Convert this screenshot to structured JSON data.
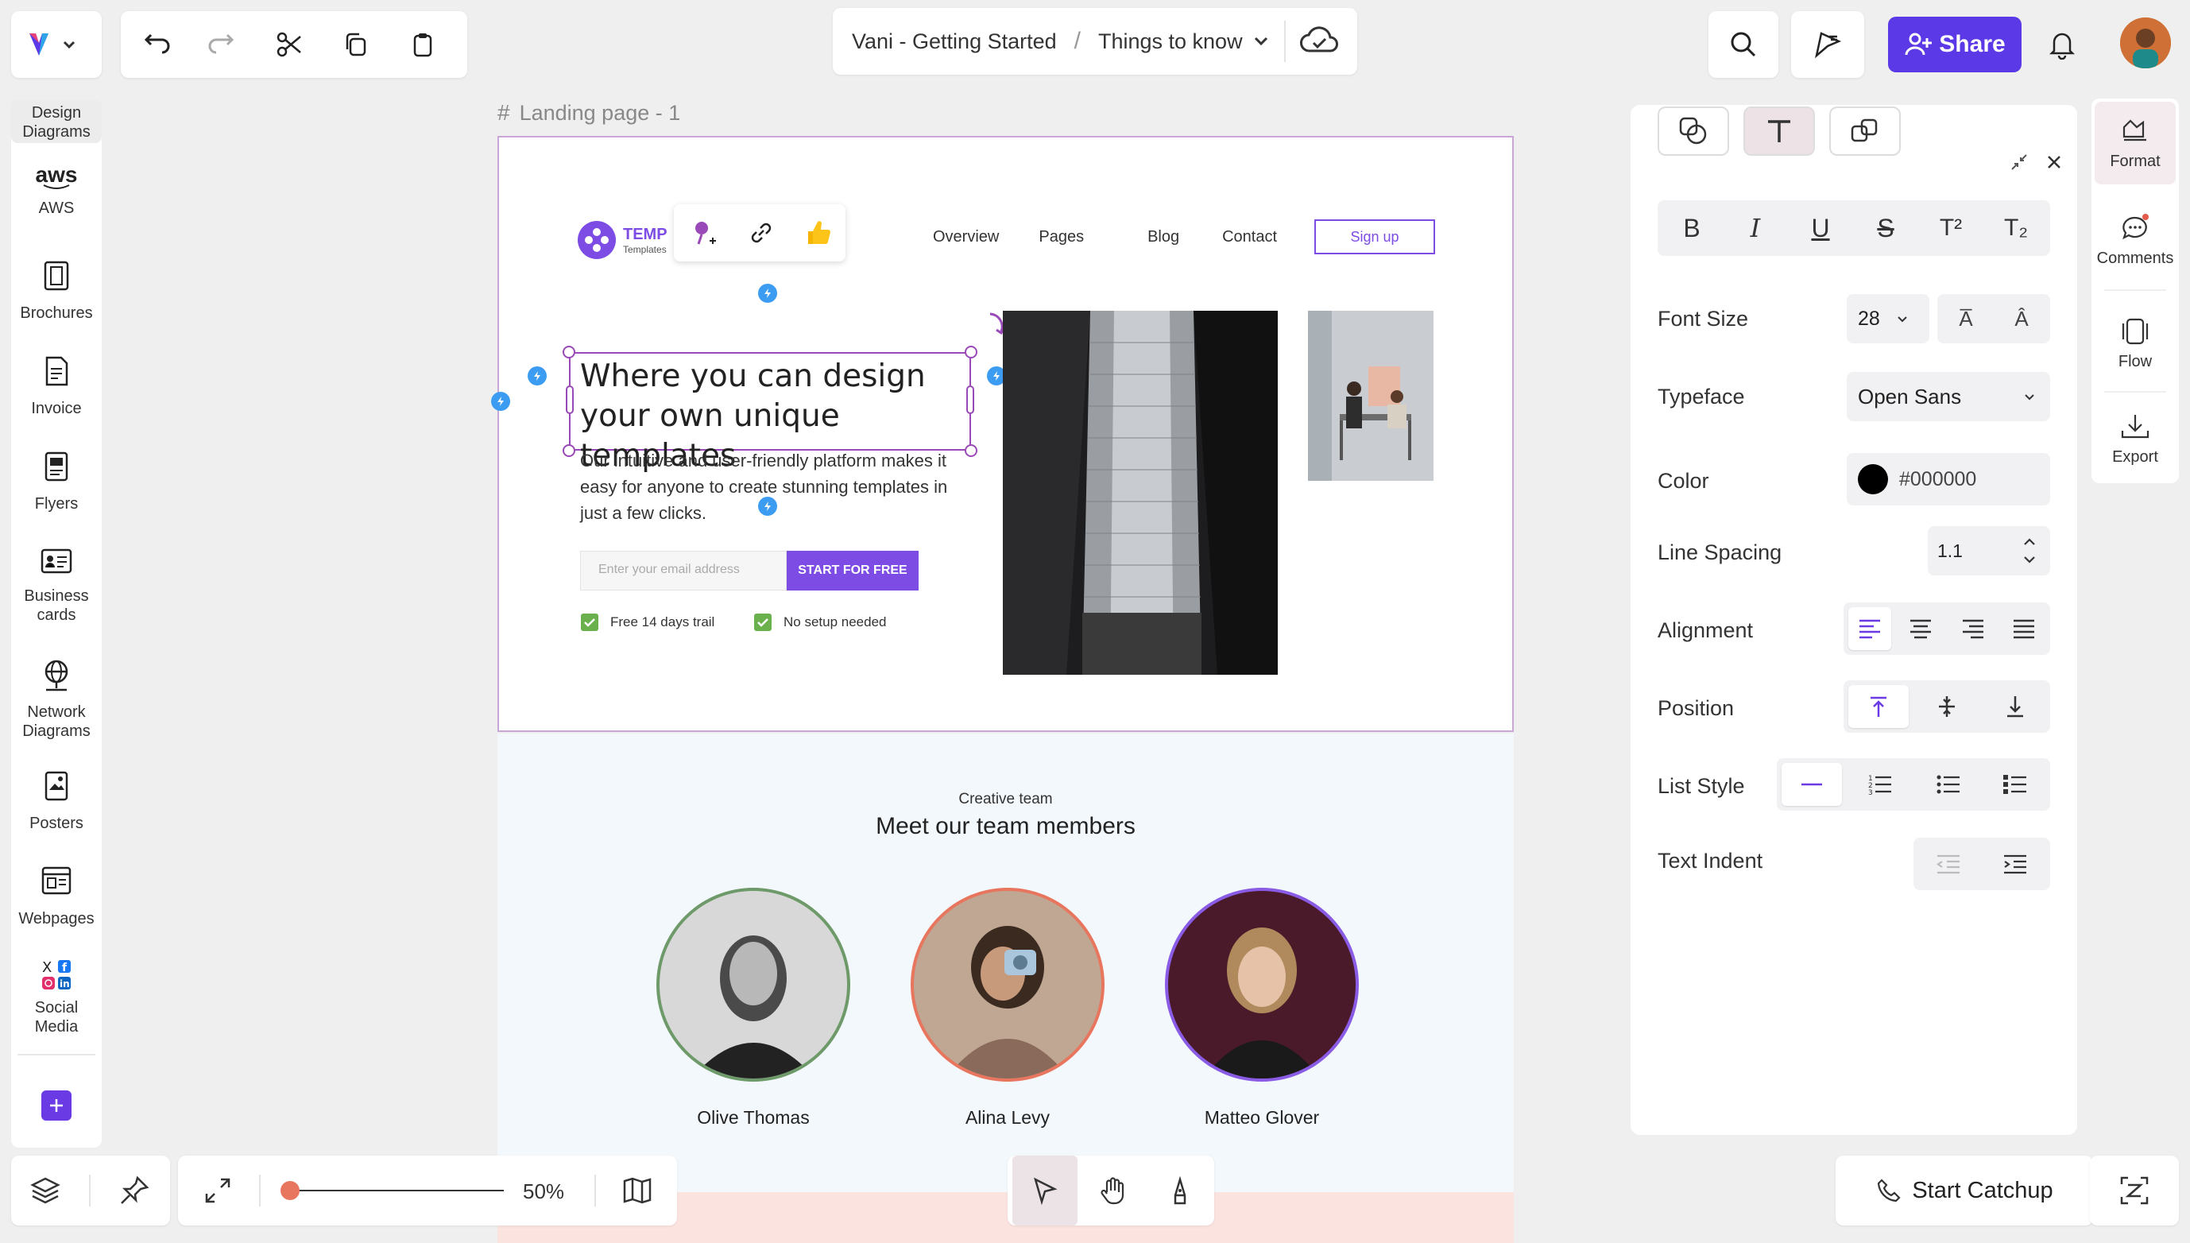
{
  "app": {
    "breadcrumb_project": "Vani - Getting Started",
    "breadcrumb_sep": "/",
    "breadcrumb_page": "Things to know",
    "share_label": "Share",
    "accent": "#5b39e6"
  },
  "sidebar": {
    "items": [
      {
        "label": "Design Diagrams",
        "icon": "design-diagrams"
      },
      {
        "label": "AWS",
        "icon": "aws-logo"
      },
      {
        "label": "Brochures",
        "icon": "brochure-icon"
      },
      {
        "label": "Invoice",
        "icon": "invoice-icon"
      },
      {
        "label": "Flyers",
        "icon": "flyer-icon"
      },
      {
        "label": "Business cards",
        "icon": "business-card-icon"
      },
      {
        "label": "Network Diagrams",
        "icon": "network-icon"
      },
      {
        "label": "Posters",
        "icon": "poster-icon"
      },
      {
        "label": "Webpages",
        "icon": "webpage-icon"
      },
      {
        "label": "Social Media",
        "icon": "social-media-icon"
      }
    ],
    "aws_text": "aws"
  },
  "frame": {
    "label": "Landing page - 1",
    "logo_text": "TEMP",
    "logo_sub": "Templates",
    "nav": [
      "Overview",
      "Pages",
      "Blog",
      "Contact"
    ],
    "signup": "Sign up",
    "headline": "Where you can design your own unique templates",
    "body": "Our intuitive and user-friendly platform makes it easy for anyone to create stunning templates in just a few clicks.",
    "email_placeholder": "Enter your email address",
    "cta": "START FOR FREE",
    "check1": "Free 14 days trail",
    "check2": "No setup needed"
  },
  "team": {
    "eyebrow": "Creative team",
    "title": "Meet our team members",
    "members": [
      {
        "name": "Olive Thomas",
        "ring": "#6e9a6a"
      },
      {
        "name": "Alina Levy",
        "ring": "#e8765f"
      },
      {
        "name": "Matteo Glover",
        "ring": "#8a5ce6"
      }
    ]
  },
  "format_panel": {
    "font_size_label": "Font Size",
    "font_size_value": "28",
    "typeface_label": "Typeface",
    "typeface_value": "Open Sans",
    "color_label": "Color",
    "color_value": "#000000",
    "line_spacing_label": "Line Spacing",
    "line_spacing_value": "1.1",
    "alignment_label": "Alignment",
    "position_label": "Position",
    "list_style_label": "List Style",
    "text_indent_label": "Text Indent",
    "style_buttons": [
      "B",
      "I",
      "U",
      "S",
      "T²",
      "T₂"
    ]
  },
  "right_rail": {
    "format": "Format",
    "comments": "Comments",
    "flow": "Flow",
    "export": "Export"
  },
  "bottom": {
    "zoom": "50%",
    "zoom_level": 0.04,
    "catchup": "Start Catchup"
  }
}
